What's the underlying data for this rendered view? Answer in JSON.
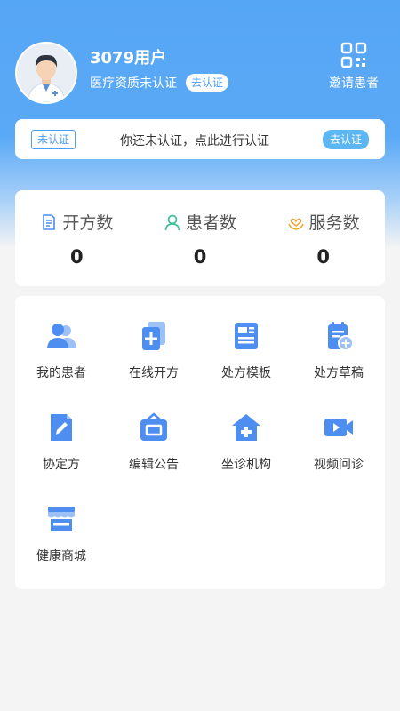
{
  "profile": {
    "user_name": "3079用户",
    "qualification_status": "医疗资质未认证",
    "certify_button": "去认证",
    "invite_label": "邀请患者"
  },
  "notice": {
    "badge": "未认证",
    "text": "你还未认证，点此进行认证",
    "button": "去认证"
  },
  "stats": [
    {
      "label": "开方数",
      "value": "0",
      "icon": "prescription-doc-icon"
    },
    {
      "label": "患者数",
      "value": "0",
      "icon": "person-icon"
    },
    {
      "label": "服务数",
      "value": "0",
      "icon": "heart-hand-icon"
    }
  ],
  "menu": [
    {
      "label": "我的患者",
      "icon": "patients-icon"
    },
    {
      "label": "在线开方",
      "icon": "online-prescription-icon"
    },
    {
      "label": "处方模板",
      "icon": "template-icon"
    },
    {
      "label": "处方草稿",
      "icon": "draft-icon"
    },
    {
      "label": "协定方",
      "icon": "agreement-icon"
    },
    {
      "label": "编辑公告",
      "icon": "announcement-icon"
    },
    {
      "label": "坐诊机构",
      "icon": "clinic-icon"
    },
    {
      "label": "视频问诊",
      "icon": "video-icon"
    },
    {
      "label": "健康商城",
      "icon": "store-icon"
    }
  ],
  "colors": {
    "header_blue": "#55a6f5",
    "accent_blue": "#4a9ff3",
    "icon_blue": "#4d8ef0",
    "stat_icon_green": "#3cbf9a",
    "stat_icon_orange": "#f2a63a"
  }
}
